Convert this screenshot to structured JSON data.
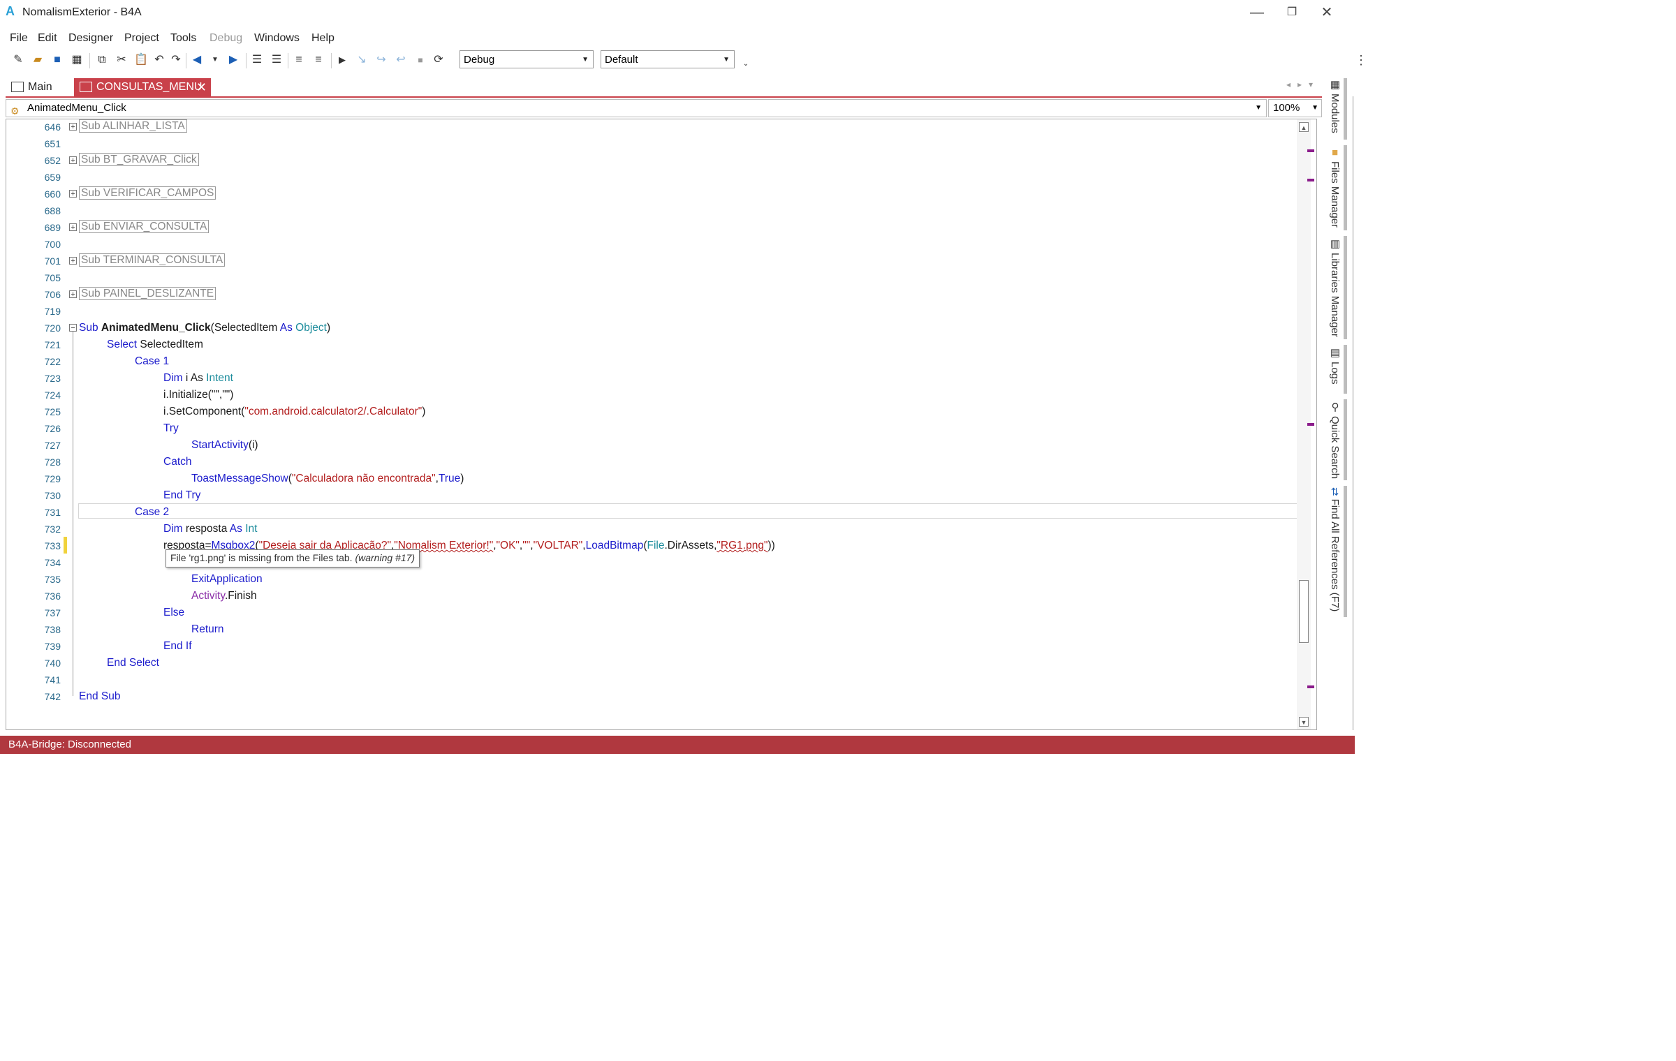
{
  "window": {
    "logo": "A",
    "title": "NomalismExterior - B4A",
    "minimize": "—",
    "restore": "❐",
    "close": "✕"
  },
  "menu": {
    "items": [
      {
        "label": "File"
      },
      {
        "label": "Edit"
      },
      {
        "label": "Designer"
      },
      {
        "label": "Project"
      },
      {
        "label": "Tools"
      },
      {
        "label": "Debug",
        "disabled": true
      },
      {
        "label": "Windows"
      },
      {
        "label": "Help"
      }
    ]
  },
  "toolbar": {
    "build_config": "Debug",
    "build_target": "Default",
    "overflow": "⋮"
  },
  "tabs": {
    "main": "Main",
    "consultas": "CONSULTAS_MENU",
    "close_glyph": "✕"
  },
  "editor": {
    "sub_selector": "AnimatedMenu_Click",
    "zoom": "100%"
  },
  "code": {
    "ln646": "646",
    "sub646": "Sub ALINHAR_LISTA",
    "ln651": "651",
    "ln652": "652",
    "sub652": "Sub BT_GRAVAR_Click",
    "ln659": "659",
    "ln660": "660",
    "sub660": "Sub VERIFICAR_CAMPOS",
    "ln688": "688",
    "ln689": "689",
    "sub689": "Sub ENVIAR_CONSULTA",
    "ln700": "700",
    "ln701": "701",
    "sub701": "Sub TERMINAR_CONSULTA",
    "ln705": "705",
    "ln706": "706",
    "sub706": "Sub PAINEL_DESLIZANTE",
    "ln719": "719",
    "ln720": "720",
    "ln721": "721",
    "ln722": "722",
    "ln723": "723",
    "ln724": "724",
    "ln725": "725",
    "ln726": "726",
    "ln727": "727",
    "ln728": "728",
    "ln729": "729",
    "ln730": "730",
    "ln731": "731",
    "ln732": "732",
    "ln733": "733",
    "ln734": "734",
    "ln735": "735",
    "ln736": "736",
    "ln737": "737",
    "ln738": "738",
    "ln739": "739",
    "ln740": "740",
    "ln741": "741",
    "ln742": "742",
    "t_sub": "Sub",
    "t_name": "AnimatedMenu_Click",
    "t_params": "(SelectedItem",
    "t_as": "As",
    "t_object": "Object",
    "t_close": ")",
    "t_select": "Select",
    "t_selecteditem": "SelectedItem",
    "t_case1": "Case 1",
    "t_dim": "Dim",
    "t_i_as": "i As",
    "t_intent": "Intent",
    "t_init": "i.Initialize(\"\",\"\")",
    "t_setcomp_a": "i.SetComponent(",
    "t_setcomp_s": "\"com.android.calculator2/.Calculator\"",
    "t_setcomp_b": ")",
    "t_try": "Try",
    "t_startact": "StartActivity",
    "t_startact_arg": "(i)",
    "t_catch": "Catch",
    "t_toast": "ToastMessageShow",
    "t_toast_a": "(",
    "t_toast_s": "\"Calculadora não encontrada\"",
    "t_toast_b": ",",
    "t_true": "True",
    "t_toast_c": ")",
    "t_endtry": "End Try",
    "t_case2": "Case 2",
    "t_resposta": "resposta",
    "t_as2": "As",
    "t_int": "Int",
    "t_resp_a": "resposta=",
    "t_msgbox": "Msgbox2",
    "t_mb_open": "(",
    "t_mb_s1": "\"Deseja sair da Aplicação?\"",
    "t_comma": ",",
    "t_mb_s2": "\"Nomalism Exterior!\"",
    "t_mb_s3": "\"OK\"",
    "t_mb_s4": "\"\"",
    "t_mb_s5": "\"VOLTAR\"",
    "t_loadbmp": "LoadBitmap",
    "t_file": "File",
    "t_dirassets": ".DirAssets,",
    "t_mb_s6": "\"RG1.png\"",
    "t_mb_close": "))",
    "t_exitapp": "ExitApplication",
    "t_activity": "Activity",
    "t_finish": ".Finish",
    "t_else": "Else",
    "t_return": "Return",
    "t_endif": "End If",
    "t_endselect": "End Select",
    "t_endsub": "End Sub"
  },
  "tooltip": {
    "text": "File 'rg1.png' is missing from the Files tab. ",
    "warning": "(warning #17)"
  },
  "side_panel": {
    "modules": "Modules",
    "files": "Files Manager",
    "libraries": "Libraries Manager",
    "logs": "Logs",
    "search": "Quick Search",
    "references": "Find All References (F7)"
  },
  "status": {
    "text": "B4A-Bridge: Disconnected"
  }
}
